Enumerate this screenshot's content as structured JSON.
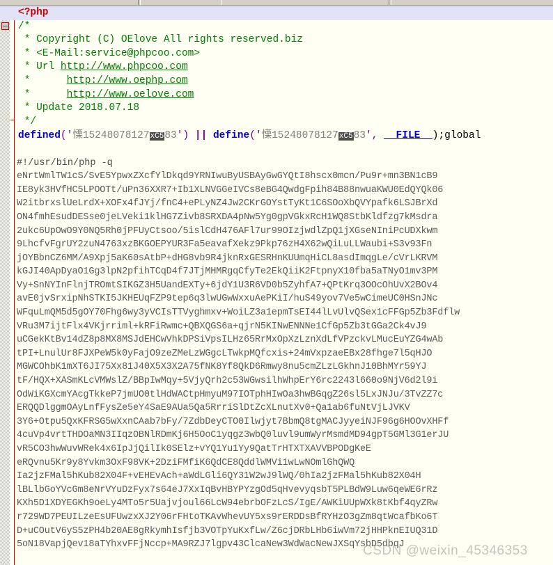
{
  "window": {
    "app": "code-editor",
    "toolbar_visible_fragment": true
  },
  "editor": {
    "background_color": "#fffff4",
    "current_line_highlight_color": "#e3e3f7",
    "fold_marker_color": "#d00000",
    "comment_color": "#008000",
    "keyword_color": "#0000d0",
    "string_color": "#808080",
    "tag_color": "#d00000"
  },
  "fold_markers": [
    {
      "type": "collapse-box",
      "style": "red",
      "line": 1
    },
    {
      "type": "collapse-box",
      "style": "grey",
      "line": 2
    },
    {
      "type": "fold-end-tick",
      "line": 9
    }
  ],
  "code": {
    "header": {
      "php_open_tag": "<?php",
      "comment_open": "/*",
      "copyright": " * Copyright (C) OElove All rights reserved.biz",
      "email": " * <E-Mail:service@phpcoo.com>",
      "url_label": " * Url ",
      "url1": "http://www.phpcoo.com",
      "url2_prefix": " *      ",
      "url2": "http://www.oephp.com",
      "url3_prefix": " *      ",
      "url3": "http://www.oelove.com",
      "update": " * Update 2018.07.18",
      "comment_close": " */"
    },
    "defined_line": {
      "fn1": "defined",
      "open1": "('",
      "cjk1": "慄",
      "digits1": "15248078127",
      "ctrl1": "xC5",
      "digits1b": "83",
      "close1": "')",
      "or": " || ",
      "fn2": "define",
      "open2": "('",
      "cjk2": "慄",
      "digits2": "15248078127",
      "ctrl2": "xC5",
      "digits2b": "83",
      "close2": "', ",
      "magic": "__FILE__",
      "tail": ");global"
    },
    "shebang": "#!/usr/bin/php -q",
    "base64_lines": [
      "eNrtWmlTW1cS/SvE5YpwxZXcfYlDkqd9YRNIwuByUSBAyGwGYQtI8hscx0mcn/Pu9r+mn3BN1cB9",
      "IE8yk3HVfHC5LPOOTt/uPn36XXR7+Ib1XLNVGGeIVCs8eBG4QwdgFpih84B88nwuaKWU0EdQYQk06",
      "W2itbrxslUeLrdX+XOFx4fJYj/fnC4+ePLyNZ4Jw2CKrGOYstTyKt1C6SOoXbQVYpafk6LSJBrXd",
      "ON4fmhEsudDESse0jeLVeki1klHG7Zivb8SRXDA4pNw5Yg0gpVGkxRcH1WQ8StbKldfzg7kMsdra",
      "2ukc6UpOwO9Y0NQ5Rh0jPFUyCtsoo/5islCdH476AFl7ur99OIzjwdlZpQ1jXGseNIniPcUDXkwm",
      "9LhcfvFgrUY2zuN4763xzBKGOEPYUR3Fa5eavafXekz9Pkp76zH4X62wQiLuLLWaubi+S3v93Fn",
      "jOYBbnCZ6MM/A9Xpj5aK60sAtbP+dHG8vb9R4jknRxGESRHnKUUmqHiCL8asdImqgLe/cVrLKRVM",
      "kGJI40ApDyaO1Gg3lpN2pfihTCqD4f7JTjMHMRgqCfyTe2EkQiiK2FtpnyX10fba5aTNyO1mv3PM",
      "Vy+SnNYInFlnjTROmtSIKGZ3H5UandEXTy+6jdY1U3R6VD0b5ZyhfA7+QPtKrq3OOcOhUvX2BOv4",
      "avE0jvSrxipNhSTKI5JKHEUqFZP9tep6q3lwUGwWxxuAePKiI/huS49yov7Ve5wCimeUC0HSnJNc",
      "WFquLmQM5d5gOY70Fhg6wy3yVCIsTTVyghmxv+WoiLZ3a1epmTsEI44lLvUlvQSex1cFFGp5Zb3Fdflw",
      "VRu3M7ijtFlx4VKjrriml+kRFiRwmc+QBXQGS6a+qjrN5KINwENNNe1CfGp5Zb3tGGa2Ck4vJ9",
      "uCGekKtBv14dZ8p8MX8MSJdEHCwVhkDPSiVpsILHz65RrMxOpXzLznXdLfVPzckvLMucEuYZG4wAb",
      "tPI+LnulUr8FJXPeW5k0yFajO9zeZMeLzWGgcLTwkpMQfcxis+24mVxpzaeEBx28fhge7l5qHJO",
      "MGWCOhbK1mXT6JI75Xx81J40X5X3X2A75fNK8Yf8QkD6Rmwy8nu5cmZLzLGkhnJ10BhMYr59YJ",
      "tF/HQX+XASmKLcVMWslZ/BBpIwMqy+5VjyQrh2c53WGwsilhWhpErY6rc2243l660o9NjV6d2l9i",
      "OdWiKGXcmYAcgTkkeP7jmUO0tlHdWACtpHmyuM97IOTphHIwOa3hwBGqgZ26sl5LxJNJu/3TvZZ7c",
      "ERQQDlggmOAyLnfFysZe5eY4SaE9AUa5Qa5RrriSlDtZcXLnutXv0+Qa1ab6fuNtVjLJVKV",
      "3Y6+Otpu5QxKFRSG5wXxnCAab7bFy/7ZdbDeyCTO0Ilwjyt7BbmQ8tgMACJyyeiNJF96g6HOOvXHFf",
      "4cuVp4vrtTHDOaMN3IIqzOBNlRDmKj6H5OoC1yqgz3wbQ0luvl9umWyrMsmdMD94gpT5GMl3G1erJU",
      "vR5CO3hwWuvWRek4x6IpJjQilIk0SElz+vYQ1Yu1Yy9QatTrHTXTXAVVBPODgKeE",
      "eRQvnu5Kr9y8Yvkm3OxF98VK+2DziFMfiK6QdCE8QddlWMVi1wLwNOmlGhQWQ",
      "Ia2jzFMal5hKub82X04F+vEHEvAch+aWdLGli6QY31W2wJ9lWQ/0hIa2jzFMal5hKub82X04H",
      "lBLlbGoYVcGm8eNrVYuDzFyx7s64eJ7XxIqBvHBYPYzgOd5qHvevyqsbT5PLBdW9Luw6qeWE6rRz",
      "KXh5D1XDYEGKh9oeLy4MTo5r5Uajvjoul66LcW94ebrbOFzLcS/IgE/AWKiUUpWXk8tKbf4qyZRw",
      "r729WD7PEUILzeEsUFUwzxXJ2Y06rFHtoTKAvWhevUY5xs9rERDDsBfRYHzO3gZm8qtWcafbKo6T",
      "D+uCOutV6yS5zPH4b20AE8gRkymhIsfjb3VOTpYuKxfLw/Z6cjDRbLHb6iwVm72jHHPknEIUQ31D",
      "5oN18VapjQev18aTYhxvFFjNccp+MA9RZJ7lgpv43ClcaNew3WdWacNewJXSqYsbD5dbqJ"
    ]
  },
  "watermark": {
    "text": "CSDN @weixin_45346353"
  }
}
